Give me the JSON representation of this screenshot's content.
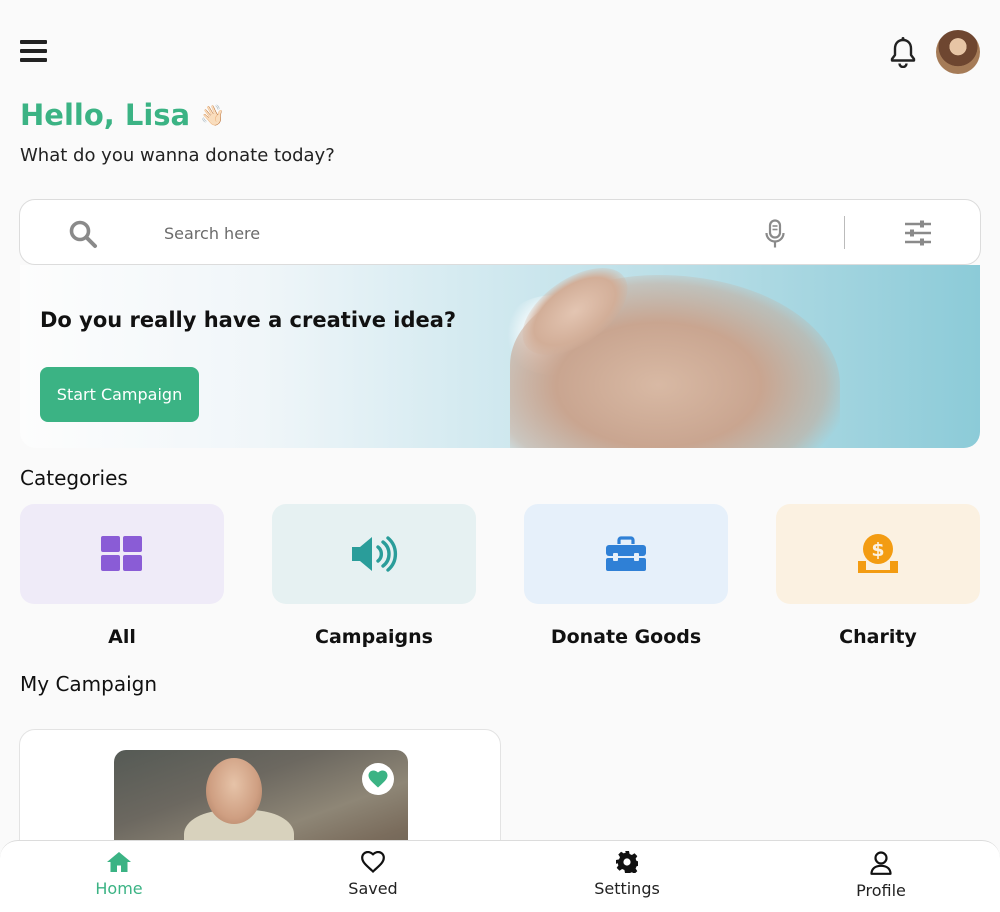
{
  "greeting": {
    "hello": "Hello, Lisa",
    "wave": "👋🏻",
    "subtitle": "What do you wanna donate today?"
  },
  "search": {
    "placeholder": "Search here"
  },
  "banner": {
    "title": "Do you really have a creative idea?",
    "cta": "Start Campaign"
  },
  "categories": {
    "title": "Categories",
    "items": [
      {
        "label": "All",
        "icon": "grid-icon",
        "bg": "#efebf8",
        "color": "#8a5cd6"
      },
      {
        "label": "Campaigns",
        "icon": "megaphone-icon",
        "bg": "#e6f1f2",
        "color": "#2a9d9a"
      },
      {
        "label": "Donate Goods",
        "icon": "toolbox-icon",
        "bg": "#e6f0fa",
        "color": "#2f80d6"
      },
      {
        "label": "Charity",
        "icon": "coin-hand-icon",
        "bg": "#fbf1e1",
        "color": "#f39c12"
      }
    ]
  },
  "my_campaign": {
    "title": "My Campaign"
  },
  "nav": {
    "items": [
      {
        "label": "Home",
        "icon": "home-icon",
        "active": true
      },
      {
        "label": "Saved",
        "icon": "heart-icon",
        "active": false
      },
      {
        "label": "Settings",
        "icon": "gear-icon",
        "active": false
      },
      {
        "label": "Profile",
        "icon": "user-icon",
        "active": false
      }
    ]
  },
  "colors": {
    "accent": "#3bb384",
    "text": "#111111"
  }
}
